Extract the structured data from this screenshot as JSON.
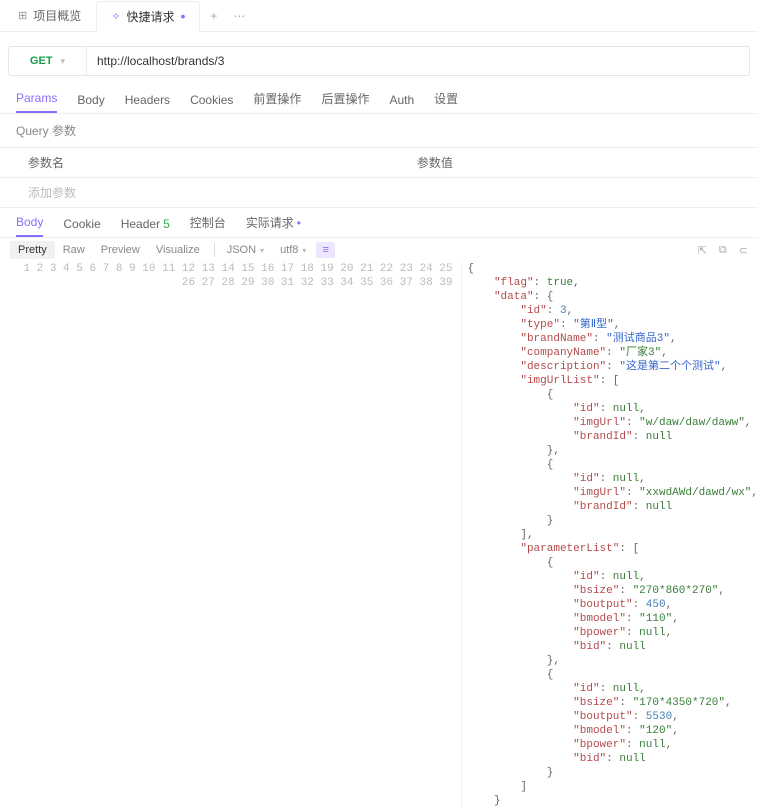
{
  "top_tabs": {
    "overview_icon": "⊞",
    "overview_label": "项目概览",
    "active_icon": "✧",
    "active_label": "快捷请求",
    "add_icon": "+",
    "more_icon": "⋯"
  },
  "request": {
    "method": "GET",
    "url": "http://localhost/brands/3"
  },
  "req_tabs": [
    "Params",
    "Body",
    "Headers",
    "Cookies",
    "前置操作",
    "后置操作",
    "Auth",
    "设置"
  ],
  "req_active": 0,
  "query": {
    "title": "Query 参数",
    "col_name": "参数名",
    "col_value": "参数值",
    "add_placeholder": "添加参数"
  },
  "resp_tabs": [
    {
      "label": "Body"
    },
    {
      "label": "Cookie"
    },
    {
      "label": "Header",
      "badge": "5"
    },
    {
      "label": "控制台"
    },
    {
      "label": "实际请求",
      "dot": true
    }
  ],
  "resp_active": 0,
  "toolbar": {
    "modes": [
      "Pretty",
      "Raw",
      "Preview",
      "Visualize"
    ],
    "mode_active": 0,
    "format": "JSON",
    "encoding": "utf8",
    "filter_icon": "≡",
    "right_icons": [
      "⇱",
      "⧉",
      "⊂"
    ]
  },
  "json_raw": {
    "flag": true,
    "data": {
      "id": 3,
      "type": "第Ⅱ型",
      "brandName": "测试商品3",
      "companyName": "厂家3",
      "description": "这是第二个个测试",
      "imgUrlList": [
        {
          "id": null,
          "imgUrl": "w/daw/daw/daww",
          "brandId": null
        },
        {
          "id": null,
          "imgUrl": "xxwdAWd/dawd/wx",
          "brandId": null
        }
      ],
      "parameterList": [
        {
          "id": null,
          "bsize": "270*860*270",
          "boutput": 450,
          "bmodel": "110",
          "bpower": null,
          "bid": null
        },
        {
          "id": null,
          "bsize": "170*4350*720",
          "boutput": 5530,
          "bmodel": "120",
          "bpower": null,
          "bid": null
        }
      ]
    }
  },
  "json_lines": [
    {
      "n": 1,
      "html": "<span class='p'>{</span>"
    },
    {
      "n": 2,
      "html": "    <span class='k'>\"flag\"</span><span class='p'>: </span><span class='v'>true</span><span class='p'>,</span>"
    },
    {
      "n": 3,
      "html": "    <span class='k'>\"data\"</span><span class='p'>: {</span>"
    },
    {
      "n": 4,
      "html": "        <span class='k'>\"id\"</span><span class='p'>: </span><span class='n'>3</span><span class='p'>,</span>"
    },
    {
      "n": 5,
      "html": "        <span class='t'>\"type\"</span><span class='p'>: </span><span class='s2'>\"第Ⅱ型\"</span><span class='p'>,</span>"
    },
    {
      "n": 6,
      "html": "        <span class='k'>\"brandName\"</span><span class='p'>: </span><span class='s2'>\"测试商品3\"</span><span class='p'>,</span>"
    },
    {
      "n": 7,
      "html": "        <span class='k'>\"companyName\"</span><span class='p'>: </span><span class='s'>\"厂家3\"</span><span class='p'>,</span>"
    },
    {
      "n": 8,
      "html": "        <span class='k'>\"description\"</span><span class='p'>: </span><span class='s2'>\"这是第二个个测试\"</span><span class='p'>,</span>"
    },
    {
      "n": 9,
      "html": "        <span class='k'>\"imgUrlList\"</span><span class='p'>: [</span>"
    },
    {
      "n": 10,
      "html": "            <span class='p'>{</span>"
    },
    {
      "n": 11,
      "html": "                <span class='k'>\"id\"</span><span class='p'>: </span><span class='v'>null</span><span class='p'>,</span>"
    },
    {
      "n": 12,
      "html": "                <span class='k'>\"imgUrl\"</span><span class='p'>: </span><span class='s'>\"w/daw/daw/daww\"</span><span class='p'>,</span>"
    },
    {
      "n": 13,
      "html": "                <span class='k'>\"brandId\"</span><span class='p'>: </span><span class='v'>null</span>"
    },
    {
      "n": 14,
      "html": "            <span class='p'>},</span>"
    },
    {
      "n": 15,
      "html": "            <span class='p'>{</span>"
    },
    {
      "n": 16,
      "html": "                <span class='k'>\"id\"</span><span class='p'>: </span><span class='v'>null</span><span class='p'>,</span>"
    },
    {
      "n": 17,
      "html": "                <span class='k'>\"imgUrl\"</span><span class='p'>: </span><span class='s'>\"xxwdAWd/dawd/wx\"</span><span class='p'>,</span>"
    },
    {
      "n": 18,
      "html": "                <span class='k'>\"brandId\"</span><span class='p'>: </span><span class='v'>null</span>"
    },
    {
      "n": 19,
      "html": "            <span class='p'>}</span>"
    },
    {
      "n": 20,
      "html": "        <span class='p'>],</span>"
    },
    {
      "n": 21,
      "html": "        <span class='k'>\"parameterList\"</span><span class='p'>: [</span>"
    },
    {
      "n": 22,
      "html": "            <span class='p'>{</span>"
    },
    {
      "n": 23,
      "html": "                <span class='k'>\"id\"</span><span class='p'>: </span><span class='v'>null</span><span class='p'>,</span>"
    },
    {
      "n": 24,
      "html": "                <span class='k'>\"bsize\"</span><span class='p'>: </span><span class='s'>\"270*860*270\"</span><span class='p'>,</span>"
    },
    {
      "n": 25,
      "html": "                <span class='k'>\"boutput\"</span><span class='p'>: </span><span class='n'>450</span><span class='p'>,</span>"
    },
    {
      "n": 26,
      "html": "                <span class='k'>\"bmodel\"</span><span class='p'>: </span><span class='s'>\"110\"</span><span class='p'>,</span>"
    },
    {
      "n": 27,
      "html": "                <span class='k'>\"bpower\"</span><span class='p'>: </span><span class='v'>null</span><span class='p'>,</span>"
    },
    {
      "n": 28,
      "html": "                <span class='k'>\"bid\"</span><span class='p'>: </span><span class='v'>null</span>"
    },
    {
      "n": 29,
      "html": "            <span class='p'>},</span>"
    },
    {
      "n": 30,
      "html": "            <span class='p'>{</span>"
    },
    {
      "n": 31,
      "html": "                <span class='k'>\"id\"</span><span class='p'>: </span><span class='v'>null</span><span class='p'>,</span>"
    },
    {
      "n": 32,
      "html": "                <span class='k'>\"bsize\"</span><span class='p'>: </span><span class='s'>\"170*4350*720\"</span><span class='p'>,</span>"
    },
    {
      "n": 33,
      "html": "                <span class='k'>\"boutput\"</span><span class='p'>: </span><span class='n'>5530</span><span class='p'>,</span>"
    },
    {
      "n": 34,
      "html": "                <span class='k'>\"bmodel\"</span><span class='p'>: </span><span class='s'>\"120\"</span><span class='p'>,</span>"
    },
    {
      "n": 35,
      "html": "                <span class='k'>\"bpower\"</span><span class='p'>: </span><span class='v'>null</span><span class='p'>,</span>"
    },
    {
      "n": 36,
      "html": "                <span class='k'>\"bid\"</span><span class='p'>: </span><span class='v'>null</span>"
    },
    {
      "n": 37,
      "html": "            <span class='p'>}</span>"
    },
    {
      "n": 38,
      "html": "        <span class='p'>]</span>"
    },
    {
      "n": 39,
      "html": "    <span class='p'>}</span>"
    }
  ]
}
